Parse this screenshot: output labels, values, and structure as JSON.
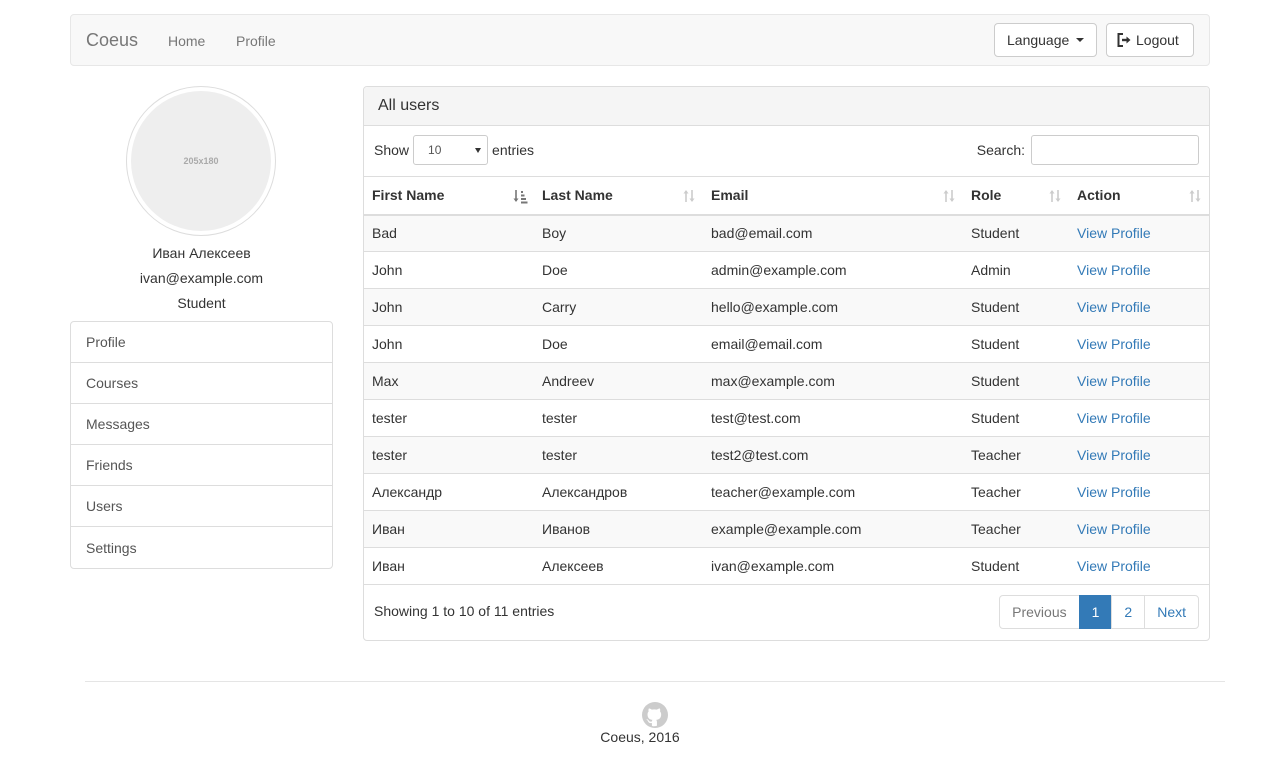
{
  "navbar": {
    "brand": "Coeus",
    "links": [
      "Home",
      "Profile"
    ],
    "language_label": "Language",
    "logout_label": "Logout"
  },
  "sidebar": {
    "avatar_placeholder": "205x180",
    "user_name": "Иван Алексеев",
    "user_email": "ivan@example.com",
    "user_role": "Student",
    "items": [
      "Profile",
      "Courses",
      "Messages",
      "Friends",
      "Users",
      "Settings"
    ]
  },
  "panel": {
    "title": "All users",
    "show_label": "Show",
    "entries_value": "10",
    "entries_label": "entries",
    "search_label": "Search:",
    "search_value": "",
    "columns": [
      "First Name",
      "Last Name",
      "Email",
      "Role",
      "Action"
    ],
    "rows": [
      [
        "Bad",
        "Boy",
        "bad@email.com",
        "Student",
        "View Profile"
      ],
      [
        "John",
        "Doe",
        "admin@example.com",
        "Admin",
        "View Profile"
      ],
      [
        "John",
        "Carry",
        "hello@example.com",
        "Student",
        "View Profile"
      ],
      [
        "John",
        "Doe",
        "email@email.com",
        "Student",
        "View Profile"
      ],
      [
        "Max",
        "Andreev",
        "max@example.com",
        "Student",
        "View Profile"
      ],
      [
        "tester",
        "tester",
        "test@test.com",
        "Student",
        "View Profile"
      ],
      [
        "tester",
        "tester",
        "test2@test.com",
        "Teacher",
        "View Profile"
      ],
      [
        "Александр",
        "Александров",
        "teacher@example.com",
        "Teacher",
        "View Profile"
      ],
      [
        "Иван",
        "Иванов",
        "example@example.com",
        "Teacher",
        "View Profile"
      ],
      [
        "Иван",
        "Алексеев",
        "ivan@example.com",
        "Student",
        "View Profile"
      ]
    ],
    "info": "Showing 1 to 10 of 11 entries",
    "pagination": {
      "previous": "Previous",
      "pages": [
        "1",
        "2"
      ],
      "active_page": "1",
      "next": "Next"
    }
  },
  "footer": {
    "icon": "github-icon",
    "text": "Coeus, 2016"
  },
  "colors": {
    "link": "#337ab7",
    "active_page_bg": "#337ab7",
    "navbar_bg": "#f8f8f8"
  }
}
